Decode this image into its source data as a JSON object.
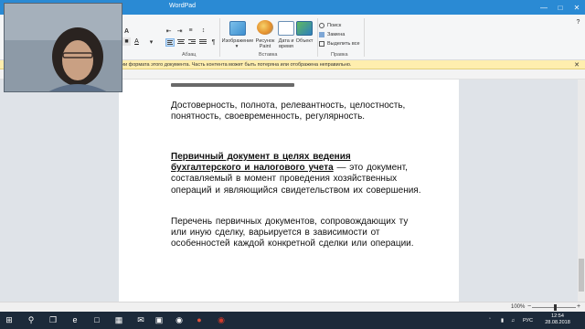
{
  "window": {
    "title": "WordPad"
  },
  "ribbon": {
    "groups": {
      "paragraph_label": "Абзац",
      "insert_label": "Вставка",
      "edit_label": "Правка"
    },
    "insert": {
      "image_label": "Изображение",
      "paint_label_1": "Рисунок",
      "paint_label_2": "Paint",
      "datetime_label_1": "Дата и",
      "datetime_label_2": "время",
      "object_label": "Объект"
    },
    "edit": {
      "find_label": "Поиск",
      "replace_label": "Замена",
      "select_all_label": "Выделить все"
    }
  },
  "infobar": {
    "message": "ии формата этого документа. Часть контента может быть потеряна или отображена неправильно."
  },
  "document": {
    "p1": "Достоверность,  полнота,  релевантность,  целостность, понятность,  своевременность,  регулярность.",
    "p2_term": "Первичный документ в целях ведения бухгалтерского и налогового учета",
    "p2_rest": " — это документ, составляемый  в  момент  проведения  хозяйственных операций  и являющийся  свидетельством  их совершения.",
    "p3": "Перечень  первичных  документов,  сопровождающих  ту или  иную  сделку,  варьируется  в  зависимости  от особенностей  каждой  конкретной  сделки  или операции."
  },
  "statusbar": {
    "zoom": "100%"
  },
  "taskbar": {
    "language": "РУС",
    "time": "12:54",
    "date": "28.08.2018"
  },
  "colors": {
    "titlebar": "#2a8ad4",
    "infobar": "#ffeeae",
    "taskbar": "#1c2a3a"
  }
}
